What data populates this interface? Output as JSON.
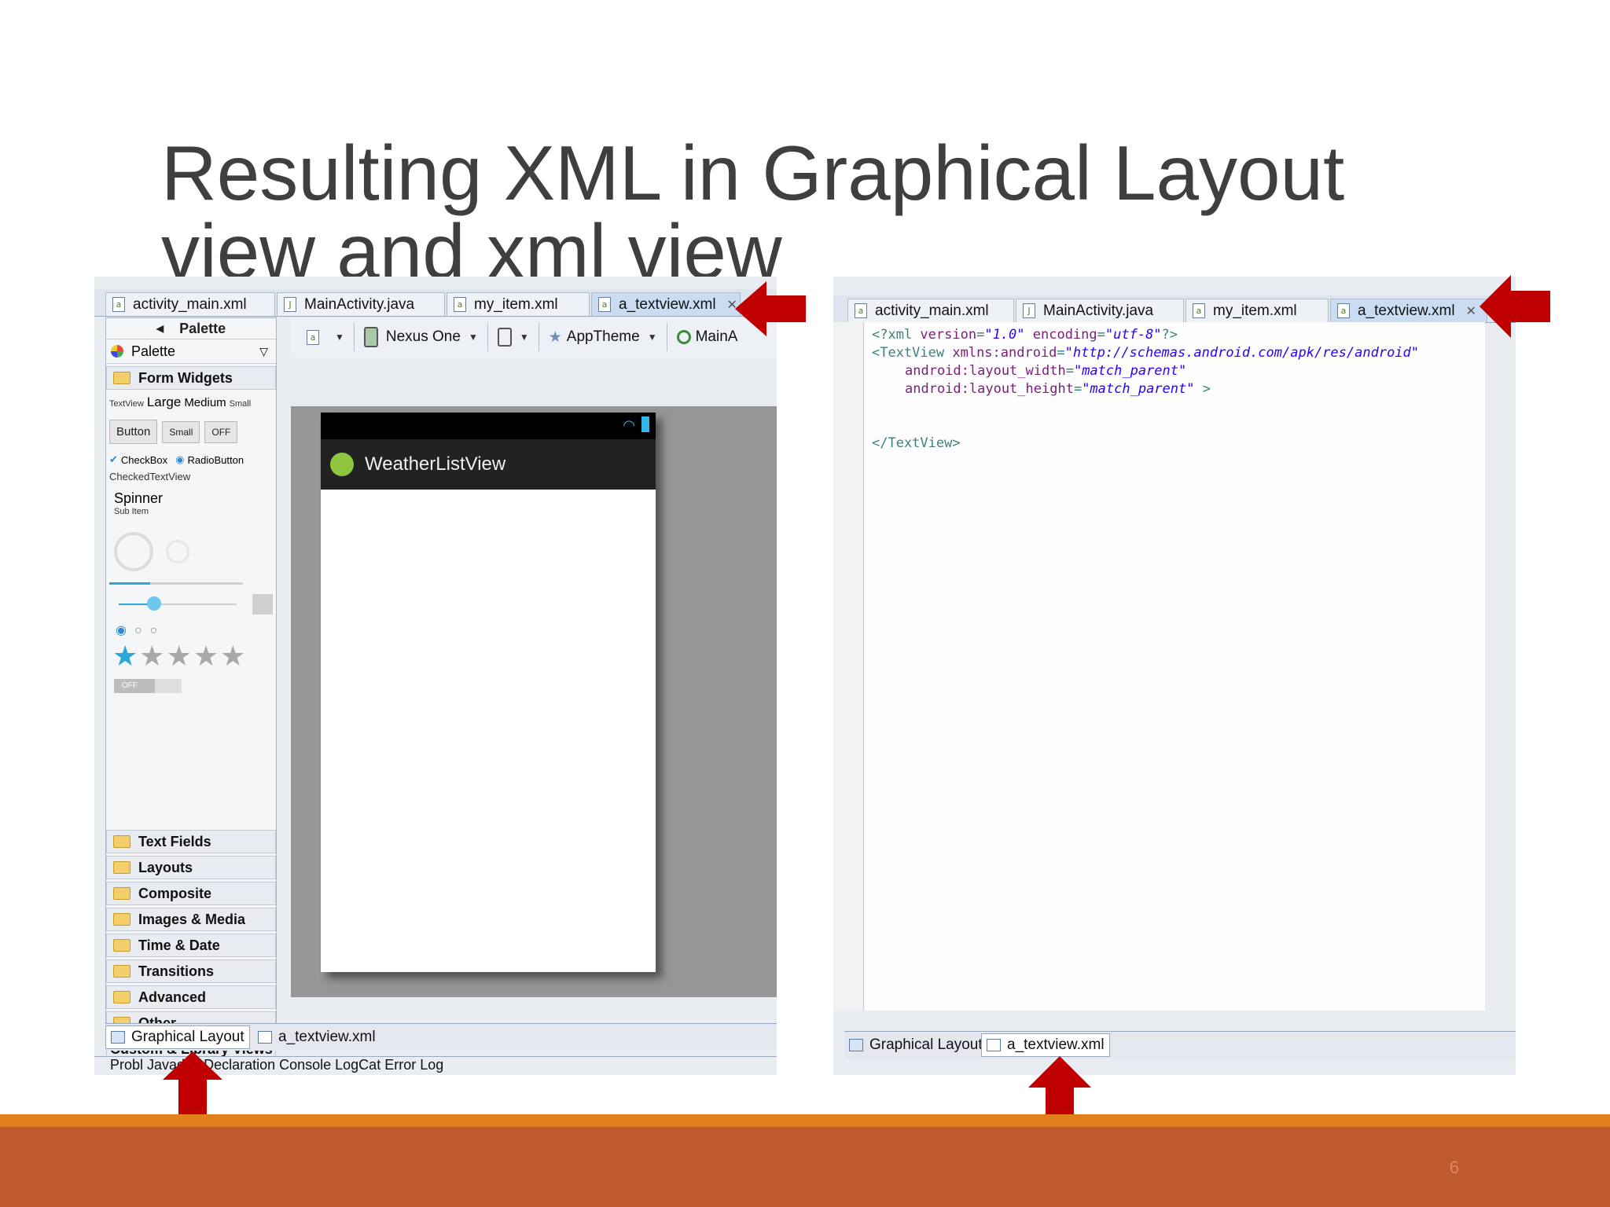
{
  "slide": {
    "title_line1": "Resulting XML in Graphical Layout",
    "title_line2": "view and xml view",
    "page_number": "6"
  },
  "left": {
    "tabs": [
      "activity_main.xml",
      "MainActivity.java",
      "my_item.xml",
      "a_textview.xml"
    ],
    "palette": {
      "header": "Palette",
      "selector": "Palette",
      "form_widgets": "Form Widgets",
      "text_sizes": {
        "tv": "TextView",
        "large": "Large",
        "medium": "Medium",
        "small": "Small"
      },
      "buttons": {
        "button": "Button",
        "small": "Small",
        "off": "OFF"
      },
      "checkbox": "CheckBox",
      "radiobutton": "RadioButton",
      "checkedtextview": "CheckedTextView",
      "spinner": "Spinner",
      "subitem": "Sub Item",
      "switch_off": "OFF",
      "categories": [
        "Text Fields",
        "Layouts",
        "Composite",
        "Images & Media",
        "Time & Date",
        "Transitions",
        "Advanced",
        "Other",
        "Custom & Library Views"
      ]
    },
    "toolbar": {
      "device": "Nexus One",
      "theme": "AppTheme",
      "activity": "MainA"
    },
    "app_title": "WeatherListView",
    "bottom_tabs": [
      "Graphical Layout",
      "a_textview.xml"
    ],
    "views": "Probl   Javadoc   Declaration   Console   LogCat   Error Log"
  },
  "right": {
    "tabs": [
      "activity_main.xml",
      "MainActivity.java",
      "my_item.xml",
      "a_textview.xml"
    ],
    "code": {
      "l1_a": "<?xml ",
      "l1_b": "version",
      "l1_c": "=",
      "l1_d": "\"1.0\"",
      "l1_e": " encoding",
      "l1_f": "=",
      "l1_g": "\"utf-8\"",
      "l1_h": "?>",
      "l2_a": "<TextView ",
      "l2_b": "xmlns:android",
      "l2_c": "=",
      "l2_d": "\"http://schemas.android.com/apk/res/android\"",
      "l3_a": "android:layout_width",
      "l3_b": "=",
      "l3_c": "\"match_parent\"",
      "l4_a": "android:layout_height",
      "l4_b": "=",
      "l4_c": "\"match_parent\"",
      "l4_d": " >",
      "l5": "</TextView>"
    },
    "bottom_tabs": [
      "Graphical Layout",
      "a_textview.xml"
    ]
  },
  "colors": {
    "arrow": "#c00000",
    "band": "#bf5a2c",
    "band_accent": "#e37f1e"
  }
}
